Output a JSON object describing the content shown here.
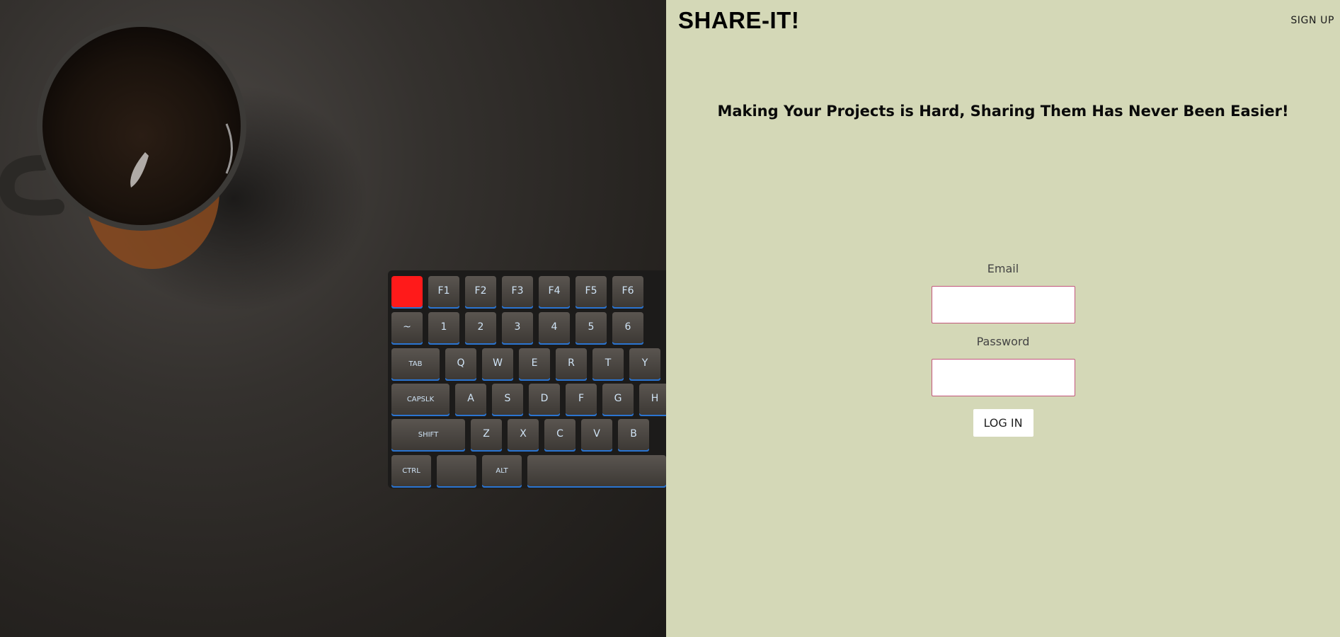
{
  "header": {
    "brand": "SHARE-IT!",
    "signup_label": "SIGN UP"
  },
  "hero": {
    "tagline": "Making Your Projects is Hard, Sharing Them Has Never Been Easier!"
  },
  "login_form": {
    "email_label": "Email",
    "email_value": "",
    "password_label": "Password",
    "password_value": "",
    "submit_label": "LOG IN"
  },
  "photo": {
    "description_icon": "coffee-mug-and-keyboard-photo",
    "keyboard_keys": {
      "row1": [
        "",
        "F1",
        "F2",
        "F3",
        "F4",
        "F5",
        "F6"
      ],
      "row2": [
        "~",
        "1",
        "2",
        "3",
        "4",
        "5",
        "6"
      ],
      "row3": [
        "TAB",
        "Q",
        "W",
        "E",
        "R",
        "T",
        "Y"
      ],
      "row4": [
        "CAPSLK",
        "A",
        "S",
        "D",
        "F",
        "G",
        "H"
      ],
      "row5": [
        "SHIFT",
        "Z",
        "X",
        "C",
        "V",
        "B"
      ],
      "row6": [
        "CTRL",
        "",
        "ALT",
        ""
      ]
    }
  },
  "colors": {
    "panel_bg": "#d4d8b7",
    "input_border": "#c2577b",
    "escape_key": "#ff1a1a",
    "key_glow": "#2e8bff"
  }
}
